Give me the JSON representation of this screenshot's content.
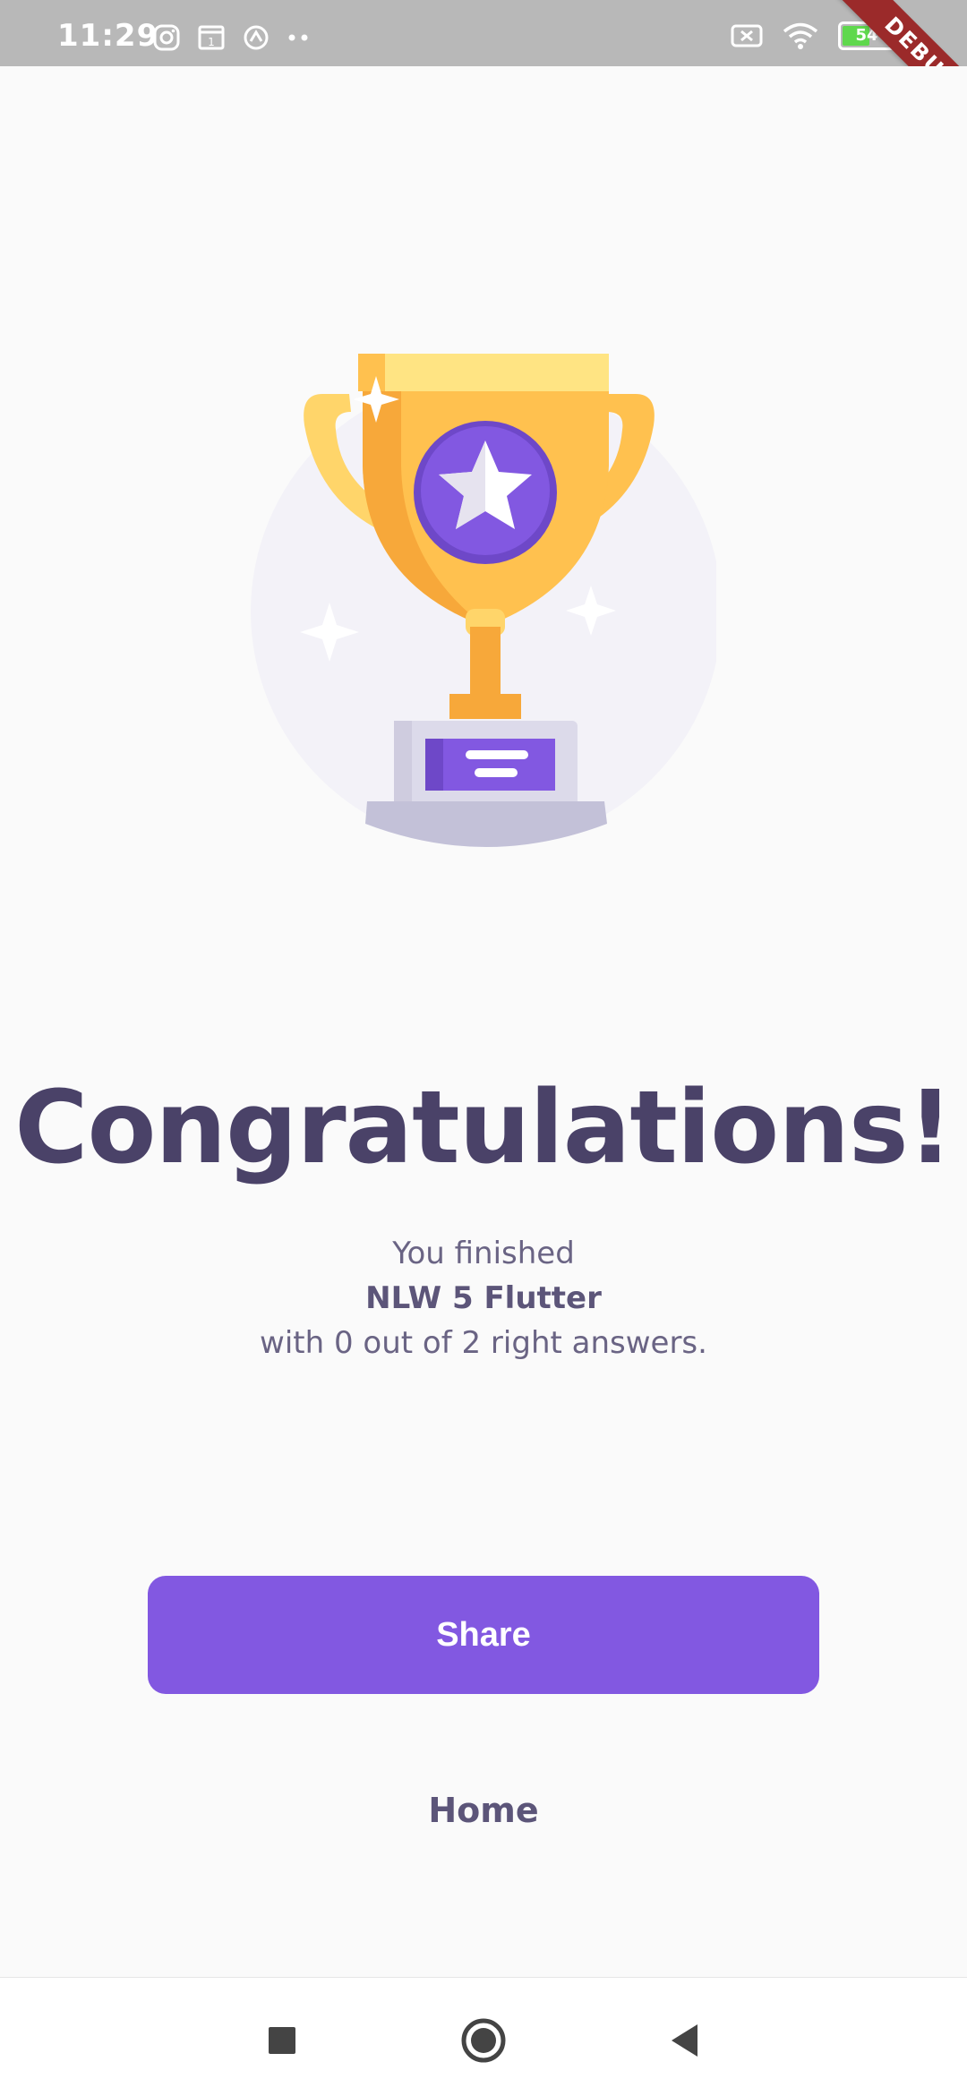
{
  "status_bar": {
    "time": "11:29",
    "battery": "54",
    "left_icons": [
      "instagram-icon",
      "calendar-icon",
      "sync-icon",
      "more-dots-icon"
    ],
    "right_icons": [
      "sim-off-icon",
      "wifi-icon",
      "battery-icon"
    ]
  },
  "debug_banner": "DEBUG",
  "result": {
    "title": "Congratulations!",
    "line1": "You finished",
    "course": "NLW 5 Flutter",
    "line3": "with 0 out of 2 right answers."
  },
  "actions": {
    "share_label": "Share",
    "home_label": "Home"
  },
  "nav": {
    "icons": [
      "recent-apps-icon",
      "home-circle-icon",
      "back-triangle-icon"
    ]
  },
  "colors": {
    "primary": "#8258e1",
    "title": "#4a4268",
    "text": "#6a6484",
    "trophy_gold": "#ffc14f",
    "trophy_light": "#ffe483"
  }
}
